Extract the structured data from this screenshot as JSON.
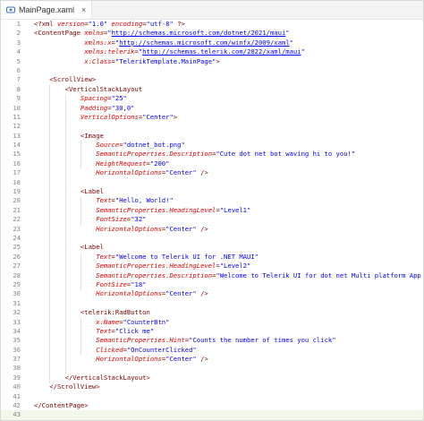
{
  "tab": {
    "label": "MainPage.xaml",
    "icon": "xml-file-icon",
    "close_symbol": "×"
  },
  "active_line": 43,
  "lines": [
    {
      "n": 1,
      "ind": 0,
      "t": [
        [
          "pun",
          "<?"
        ],
        [
          "pi",
          "xml "
        ],
        [
          "attr",
          "version"
        ],
        [
          "pun",
          "="
        ],
        [
          "str",
          "\"1.0\""
        ],
        [
          "attr",
          " encoding"
        ],
        [
          "pun",
          "="
        ],
        [
          "str",
          "\"utf-8\""
        ],
        [
          "pun",
          " ?>"
        ]
      ]
    },
    {
      "n": 2,
      "ind": 0,
      "t": [
        [
          "pun",
          "<"
        ],
        [
          "tag",
          "ContentPage "
        ],
        [
          "attr",
          "xmlns"
        ],
        [
          "pun",
          "="
        ],
        [
          "str",
          "\""
        ],
        [
          "link",
          "http://schemas.microsoft.com/dotnet/2021/maui"
        ],
        [
          "str",
          "\""
        ]
      ]
    },
    {
      "n": 3,
      "ind": 0,
      "t": [
        [
          "attr",
          "             xmlns:x"
        ],
        [
          "pun",
          "="
        ],
        [
          "str",
          "\""
        ],
        [
          "link",
          "http://schemas.microsoft.com/winfx/2009/xaml"
        ],
        [
          "str",
          "\""
        ]
      ]
    },
    {
      "n": 4,
      "ind": 0,
      "t": [
        [
          "attr",
          "             xmlns:telerik"
        ],
        [
          "pun",
          "="
        ],
        [
          "str",
          "\""
        ],
        [
          "link",
          "http://schemas.telerik.com/2022/xaml/maui"
        ],
        [
          "str",
          "\""
        ]
      ]
    },
    {
      "n": 5,
      "ind": 0,
      "t": [
        [
          "attr",
          "             x:Class"
        ],
        [
          "pun",
          "="
        ],
        [
          "str",
          "\"TelerikTemplate.MainPage\""
        ],
        [
          "pun",
          ">"
        ]
      ]
    },
    {
      "n": 6,
      "ind": 0,
      "t": []
    },
    {
      "n": 7,
      "ind": 0,
      "t": [
        [
          "pun",
          "    <"
        ],
        [
          "tag",
          "ScrollView"
        ],
        [
          "pun",
          ">"
        ]
      ]
    },
    {
      "n": 8,
      "ind": 0,
      "t": [
        [
          "pun",
          "        <"
        ],
        [
          "tag",
          "VerticalStackLayout"
        ]
      ]
    },
    {
      "n": 9,
      "ind": 0,
      "t": [
        [
          "attr",
          "            Spacing"
        ],
        [
          "pun",
          "="
        ],
        [
          "str",
          "\"25\""
        ]
      ]
    },
    {
      "n": 10,
      "ind": 0,
      "t": [
        [
          "attr",
          "            Padding"
        ],
        [
          "pun",
          "="
        ],
        [
          "str",
          "\"30,0\""
        ]
      ]
    },
    {
      "n": 11,
      "ind": 0,
      "t": [
        [
          "attr",
          "            VerticalOptions"
        ],
        [
          "pun",
          "="
        ],
        [
          "str",
          "\"Center\""
        ],
        [
          "pun",
          ">"
        ]
      ]
    },
    {
      "n": 12,
      "ind": 0,
      "t": []
    },
    {
      "n": 13,
      "ind": 0,
      "t": [
        [
          "pun",
          "            <"
        ],
        [
          "tag",
          "Image"
        ]
      ]
    },
    {
      "n": 14,
      "ind": 0,
      "t": [
        [
          "attr",
          "                Source"
        ],
        [
          "pun",
          "="
        ],
        [
          "str",
          "\"dotnet_bot.png\""
        ]
      ]
    },
    {
      "n": 15,
      "ind": 0,
      "t": [
        [
          "attr",
          "                SemanticProperties.Description"
        ],
        [
          "pun",
          "="
        ],
        [
          "str",
          "\"Cute dot net bot waving hi to you!\""
        ]
      ]
    },
    {
      "n": 16,
      "ind": 0,
      "t": [
        [
          "attr",
          "                HeightRequest"
        ],
        [
          "pun",
          "="
        ],
        [
          "str",
          "\"200\""
        ]
      ]
    },
    {
      "n": 17,
      "ind": 0,
      "t": [
        [
          "attr",
          "                HorizontalOptions"
        ],
        [
          "pun",
          "="
        ],
        [
          "str",
          "\"Center\""
        ],
        [
          "pun",
          " />"
        ]
      ]
    },
    {
      "n": 18,
      "ind": 0,
      "t": []
    },
    {
      "n": 19,
      "ind": 0,
      "t": [
        [
          "pun",
          "            <"
        ],
        [
          "tag",
          "Label"
        ]
      ]
    },
    {
      "n": 20,
      "ind": 0,
      "t": [
        [
          "attr",
          "                Text"
        ],
        [
          "pun",
          "="
        ],
        [
          "str",
          "\"Hello, World!\""
        ]
      ]
    },
    {
      "n": 21,
      "ind": 0,
      "t": [
        [
          "attr",
          "                SemanticProperties.HeadingLevel"
        ],
        [
          "pun",
          "="
        ],
        [
          "str",
          "\"Level1\""
        ]
      ]
    },
    {
      "n": 22,
      "ind": 0,
      "t": [
        [
          "attr",
          "                FontSize"
        ],
        [
          "pun",
          "="
        ],
        [
          "str",
          "\"32\""
        ]
      ]
    },
    {
      "n": 23,
      "ind": 0,
      "t": [
        [
          "attr",
          "                HorizontalOptions"
        ],
        [
          "pun",
          "="
        ],
        [
          "str",
          "\"Center\""
        ],
        [
          "pun",
          " />"
        ]
      ]
    },
    {
      "n": 24,
      "ind": 0,
      "t": []
    },
    {
      "n": 25,
      "ind": 0,
      "t": [
        [
          "pun",
          "            <"
        ],
        [
          "tag",
          "Label"
        ]
      ]
    },
    {
      "n": 26,
      "ind": 0,
      "t": [
        [
          "attr",
          "                Text"
        ],
        [
          "pun",
          "="
        ],
        [
          "str",
          "\"Welcome to Telerik UI for .NET MAUI\""
        ]
      ]
    },
    {
      "n": 27,
      "ind": 0,
      "t": [
        [
          "attr",
          "                SemanticProperties.HeadingLevel"
        ],
        [
          "pun",
          "="
        ],
        [
          "str",
          "\"Level2\""
        ]
      ]
    },
    {
      "n": 28,
      "ind": 0,
      "t": [
        [
          "attr",
          "                SemanticProperties.Description"
        ],
        [
          "pun",
          "="
        ],
        [
          "str",
          "\"Welcome to Telerik UI for dot net Multi platform App UI\""
        ]
      ]
    },
    {
      "n": 29,
      "ind": 0,
      "t": [
        [
          "attr",
          "                FontSize"
        ],
        [
          "pun",
          "="
        ],
        [
          "str",
          "\"18\""
        ]
      ]
    },
    {
      "n": 30,
      "ind": 0,
      "t": [
        [
          "attr",
          "                HorizontalOptions"
        ],
        [
          "pun",
          "="
        ],
        [
          "str",
          "\"Center\""
        ],
        [
          "pun",
          " />"
        ]
      ]
    },
    {
      "n": 31,
      "ind": 0,
      "t": []
    },
    {
      "n": 32,
      "ind": 0,
      "t": [
        [
          "pun",
          "            <"
        ],
        [
          "tag",
          "telerik:RadButton"
        ]
      ]
    },
    {
      "n": 33,
      "ind": 0,
      "t": [
        [
          "attr",
          "                x:Name"
        ],
        [
          "pun",
          "="
        ],
        [
          "str",
          "\"CounterBtn\""
        ]
      ]
    },
    {
      "n": 34,
      "ind": 0,
      "t": [
        [
          "attr",
          "                Text"
        ],
        [
          "pun",
          "="
        ],
        [
          "str",
          "\"Click me\""
        ]
      ]
    },
    {
      "n": 35,
      "ind": 0,
      "t": [
        [
          "attr",
          "                SemanticProperties.Hint"
        ],
        [
          "pun",
          "="
        ],
        [
          "str",
          "\"Counts the number of times you click\""
        ]
      ]
    },
    {
      "n": 36,
      "ind": 0,
      "t": [
        [
          "attr",
          "                Clicked"
        ],
        [
          "pun",
          "="
        ],
        [
          "str",
          "\"OnCounterClicked\""
        ]
      ]
    },
    {
      "n": 37,
      "ind": 0,
      "t": [
        [
          "attr",
          "                HorizontalOptions"
        ],
        [
          "pun",
          "="
        ],
        [
          "str",
          "\"Center\""
        ],
        [
          "pun",
          " />"
        ]
      ]
    },
    {
      "n": 38,
      "ind": 0,
      "t": []
    },
    {
      "n": 39,
      "ind": 0,
      "t": [
        [
          "pun",
          "        </"
        ],
        [
          "tag",
          "VerticalStackLayout"
        ],
        [
          "pun",
          ">"
        ]
      ]
    },
    {
      "n": 40,
      "ind": 0,
      "t": [
        [
          "pun",
          "    </"
        ],
        [
          "tag",
          "ScrollView"
        ],
        [
          "pun",
          ">"
        ]
      ]
    },
    {
      "n": 41,
      "ind": 0,
      "t": []
    },
    {
      "n": 42,
      "ind": 0,
      "t": [
        [
          "pun",
          "</"
        ],
        [
          "tag",
          "ContentPage"
        ],
        [
          "pun",
          ">"
        ]
      ]
    },
    {
      "n": 43,
      "ind": 0,
      "t": []
    }
  ]
}
